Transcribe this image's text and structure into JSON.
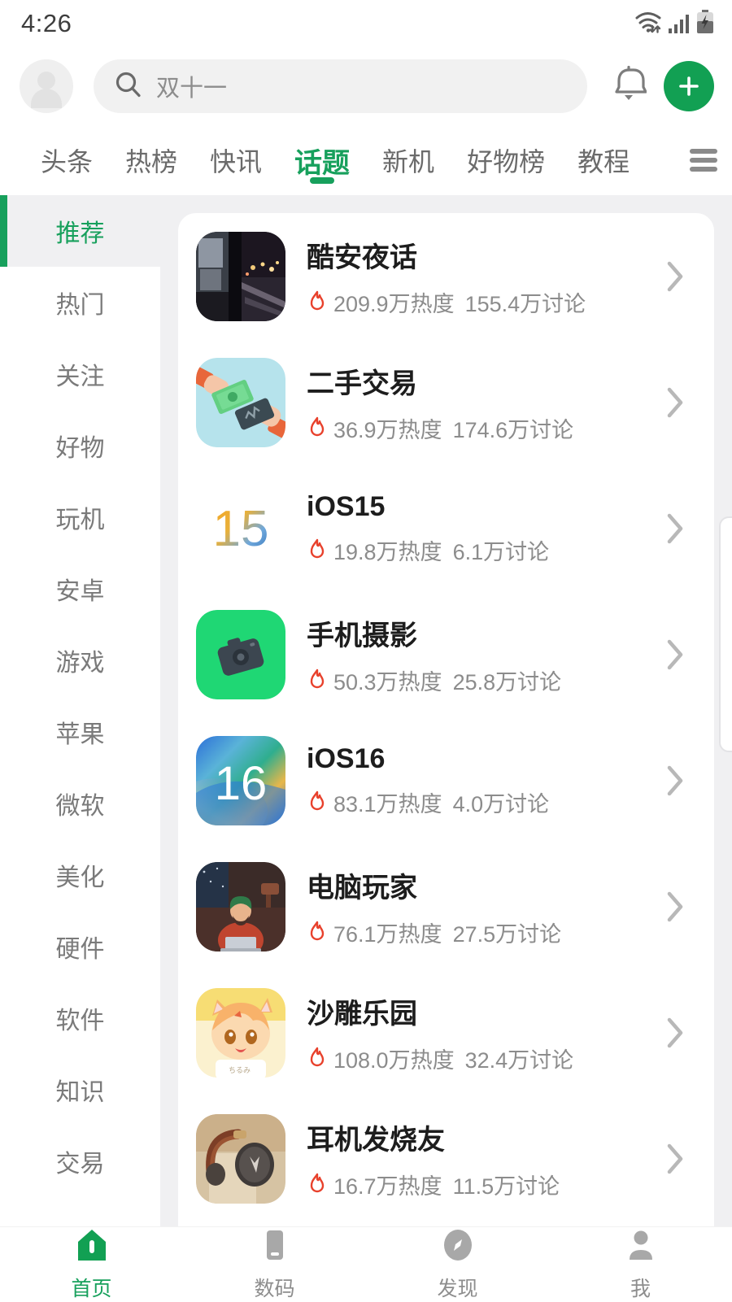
{
  "status": {
    "time": "4:26",
    "icons": [
      "wifi-icon",
      "signal-icon",
      "battery-charging-icon"
    ]
  },
  "header": {
    "avatar": "avatar",
    "search": {
      "value": "双十一",
      "icon": "search-icon"
    },
    "bell": "bell-icon",
    "fab": {
      "label": "+",
      "color": "#12a053"
    }
  },
  "top_tabs": {
    "items": [
      {
        "label": "头条",
        "active": false
      },
      {
        "label": "热榜",
        "active": false
      },
      {
        "label": "快讯",
        "active": false
      },
      {
        "label": "话题",
        "active": true
      },
      {
        "label": "新机",
        "active": false
      },
      {
        "label": "好物榜",
        "active": false
      },
      {
        "label": "教程",
        "active": false
      }
    ],
    "menu_icon": "hamburger-menu-icon"
  },
  "sidebar": {
    "items": [
      {
        "label": "推荐",
        "active": true
      },
      {
        "label": "热门",
        "active": false
      },
      {
        "label": "关注",
        "active": false
      },
      {
        "label": "好物",
        "active": false
      },
      {
        "label": "玩机",
        "active": false
      },
      {
        "label": "安卓",
        "active": false
      },
      {
        "label": "游戏",
        "active": false
      },
      {
        "label": "苹果",
        "active": false
      },
      {
        "label": "微软",
        "active": false
      },
      {
        "label": "美化",
        "active": false
      },
      {
        "label": "硬件",
        "active": false
      },
      {
        "label": "软件",
        "active": false
      },
      {
        "label": "知识",
        "active": false
      },
      {
        "label": "交易",
        "active": false
      }
    ]
  },
  "topics": [
    {
      "title": "酷安夜话",
      "heat": "209.9万热度",
      "discuss": "155.4万讨论",
      "icon": "night-street-photo-icon"
    },
    {
      "title": "二手交易",
      "heat": "36.9万热度",
      "discuss": "174.6万讨论",
      "icon": "hands-trading-money-icon"
    },
    {
      "title": "iOS15",
      "heat": "19.8万热度",
      "discuss": "6.1万讨论",
      "icon": "ios15-logo-icon"
    },
    {
      "title": "手机摄影",
      "heat": "50.3万热度",
      "discuss": "25.8万讨论",
      "icon": "camera-green-icon"
    },
    {
      "title": "iOS16",
      "heat": "83.1万热度",
      "discuss": "4.0万讨论",
      "icon": "ios16-logo-icon"
    },
    {
      "title": "电脑玩家",
      "heat": "76.1万热度",
      "discuss": "27.5万讨论",
      "icon": "person-at-laptop-icon"
    },
    {
      "title": "沙雕乐园",
      "heat": "108.0万热度",
      "discuss": "32.4万讨论",
      "icon": "anime-catgirl-icon"
    },
    {
      "title": "耳机发烧友",
      "heat": "16.7万热度",
      "discuss": "11.5万讨论",
      "icon": "headphones-icon"
    }
  ],
  "bottom_nav": {
    "items": [
      {
        "label": "首页",
        "icon": "home-icon",
        "active": true
      },
      {
        "label": "数码",
        "icon": "phone-icon",
        "active": false
      },
      {
        "label": "发现",
        "icon": "compass-icon",
        "active": false
      },
      {
        "label": "我",
        "icon": "person-icon",
        "active": false
      }
    ]
  },
  "colors": {
    "accent_green": "#17a05c",
    "fab_green": "#12a053",
    "flame_red": "#e8412c",
    "page_bg": "#f0f0f2"
  }
}
